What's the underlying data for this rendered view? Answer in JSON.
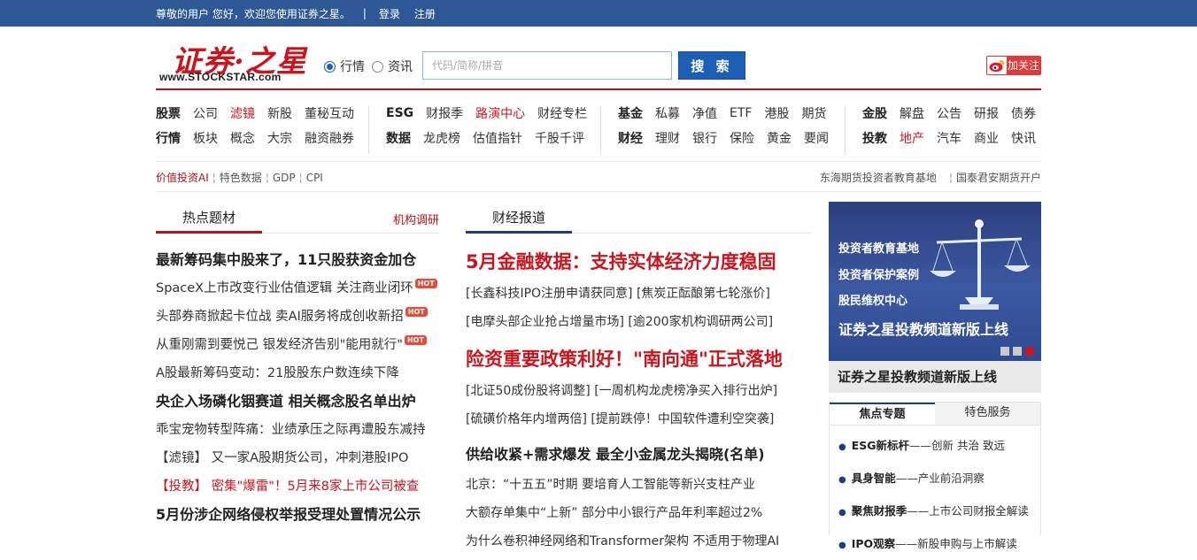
{
  "topbar": {
    "greeting": "尊敬的用户 您好，欢迎您使用证券之星。",
    "separator": "|",
    "login": "登录",
    "register": "注册"
  },
  "header": {
    "logo_cn": "证券·之星",
    "logo_en": "www.STOCKSTAR.com",
    "radio_market": "行情",
    "radio_news": "资讯",
    "search_placeholder": "代码/简称/拼音",
    "search_button": "搜 索",
    "follow_label": "加关注"
  },
  "nav": {
    "groups": [
      {
        "rows": [
          [
            {
              "t": "股票",
              "s": "b"
            },
            {
              "t": "公司"
            },
            {
              "t": "滤镜",
              "s": "r"
            },
            {
              "t": "新股"
            },
            {
              "t": "董秘互动"
            }
          ],
          [
            {
              "t": "行情",
              "s": "b"
            },
            {
              "t": "板块"
            },
            {
              "t": "概念"
            },
            {
              "t": "大宗"
            },
            {
              "t": "融资融券"
            }
          ]
        ]
      },
      {
        "rows": [
          [
            {
              "t": "ESG",
              "s": "b"
            },
            {
              "t": "财报季"
            },
            {
              "t": "路演中心",
              "s": "r"
            },
            {
              "t": "财经专栏"
            }
          ],
          [
            {
              "t": "数据",
              "s": "b"
            },
            {
              "t": "龙虎榜"
            },
            {
              "t": "估值指针"
            },
            {
              "t": "千股千评"
            }
          ]
        ]
      },
      {
        "rows": [
          [
            {
              "t": "基金",
              "s": "b"
            },
            {
              "t": "私募"
            },
            {
              "t": "净值"
            },
            {
              "t": "ETF"
            },
            {
              "t": "港股"
            },
            {
              "t": "期货"
            }
          ],
          [
            {
              "t": "财经",
              "s": "b"
            },
            {
              "t": "理财"
            },
            {
              "t": "银行"
            },
            {
              "t": "保险"
            },
            {
              "t": "黄金"
            },
            {
              "t": "要闻"
            }
          ]
        ]
      },
      {
        "rows": [
          [
            {
              "t": "金股",
              "s": "b"
            },
            {
              "t": "解盘"
            },
            {
              "t": "公告"
            },
            {
              "t": "研报"
            },
            {
              "t": "债券"
            }
          ],
          [
            {
              "t": "投教",
              "s": "b"
            },
            {
              "t": "地产",
              "s": "r"
            },
            {
              "t": "汽车"
            },
            {
              "t": "商业"
            },
            {
              "t": "快讯"
            }
          ]
        ]
      }
    ]
  },
  "subnav": {
    "left": [
      "价值投资AI",
      "特色数据",
      "GDP",
      "CPI"
    ],
    "right": [
      "东海期货投资者教育基地",
      "国泰君安期货开户"
    ]
  },
  "hot_topics": {
    "tab": "热点题材",
    "more": "机构调研",
    "items": [
      {
        "text": "最新筹码集中股来了，11只股获资金加仓",
        "style": "h"
      },
      {
        "text": "SpaceX上市改变行业估值逻辑 关注商业闭环",
        "hot": "HOT"
      },
      {
        "text": "头部券商掀起卡位战 卖AI服务将成创收新招",
        "hot": "HOT"
      },
      {
        "text": "从重刚需到要悦己 银发经济告别\"能用就行\"",
        "hot": "HOT"
      },
      {
        "text": "A股最新筹码变动：21股股东户数连续下降"
      },
      {
        "text": "央企入场磷化铟赛道 相关概念股名单出炉",
        "style": "h"
      },
      {
        "text": "乖宝宠物转型阵痛：业绩承压之际再遭股东减持"
      },
      {
        "text": "【滤镜】 又一家A股期货公司，冲刺港股IPO"
      },
      {
        "text": "【投教】 密集\"爆雷\"！5月来8家上市公司被查",
        "style": "red"
      },
      {
        "text": "5月份涉企网络侵权举报受理处置情况公示",
        "style": "h"
      }
    ]
  },
  "finance_report": {
    "tab": "财经报道",
    "headline1": "5月金融数据：支持实体经济力度稳固",
    "pair1": [
      "[长鑫科技IPO注册申请获同意]",
      "[焦炭正酝酿第七轮涨价]"
    ],
    "pair2": [
      "[电摩头部企业抢占增量市场]",
      "[逾200家机构调研两公司]"
    ],
    "headline2": "险资重要政策利好！\"南向通\"正式落地",
    "pair3": [
      "[北证50成份股将调整]",
      "[一周机构龙虎榜净买入排行出炉]"
    ],
    "pair4": [
      "[硫磺价格年内增两倍]",
      "[提前跌停！中国软件遭利空突袭]"
    ],
    "subhead": "供给收紧+需求爆发 最全小金属龙头揭晓(名单)",
    "items": [
      "北京：“十五五”时期 要培育人工智能等新兴支柱产业",
      "大额存单集中“上新” 部分中小银行产品年利率超过2%",
      "为什么卷积神经网络和Transformer架构 不适用于物理AI"
    ]
  },
  "banner": {
    "lines": [
      "投资者教育基地",
      "投资者保护案例",
      "股民维权中心"
    ],
    "title": "证券之星投教频道新版上线",
    "caption": "证券之星投教频道新版上线"
  },
  "feature_box": {
    "tabs": [
      "焦点专题",
      "特色服务"
    ],
    "items": [
      {
        "tag": "ESG新标杆",
        "text": "——创新 共治 致远"
      },
      {
        "tag": "具身智能",
        "text": "——产业前沿洞察"
      },
      {
        "tag": "聚焦财报季",
        "text": "——上市公司财报全解读"
      },
      {
        "tag": "IPO观察",
        "text": "——新股申购与上市解读"
      }
    ]
  },
  "colors": {
    "brand_blue": "#2e5895",
    "brand_red": "#c9151e",
    "search_blue": "#1e5fb6"
  }
}
